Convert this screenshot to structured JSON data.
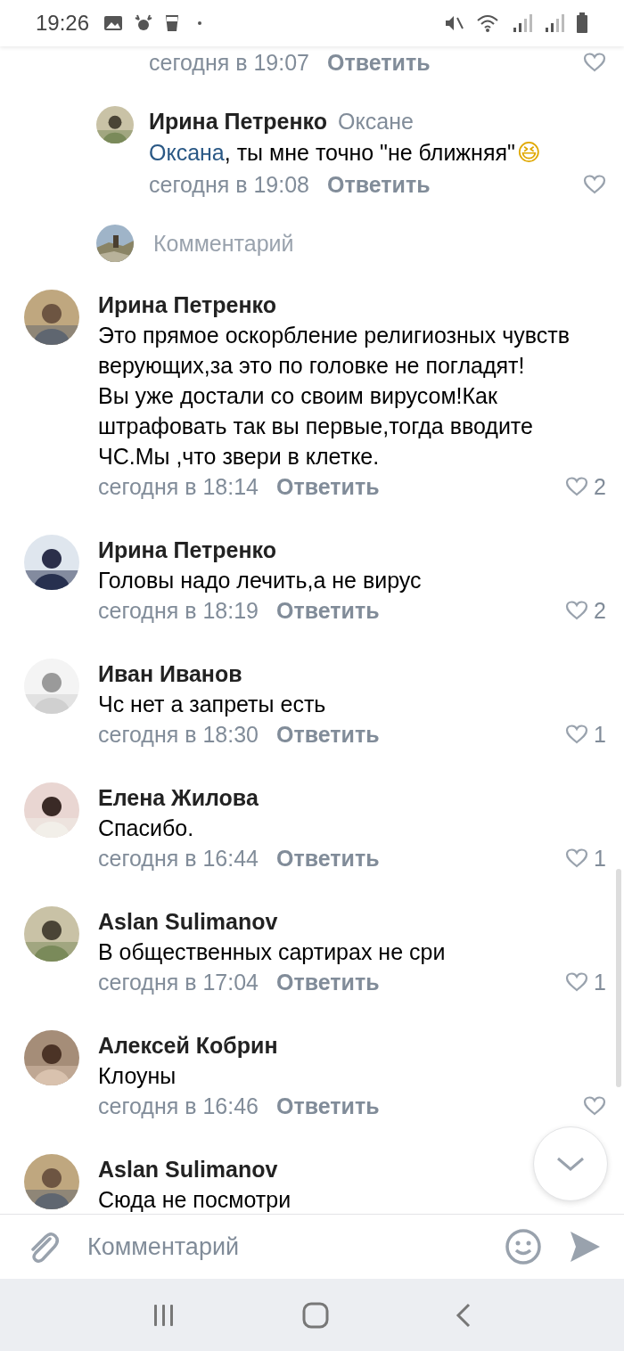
{
  "status_bar": {
    "time": "19:26"
  },
  "comments": [
    {
      "kind": "reply",
      "time": "сегодня в 19:07",
      "reply_action": "Ответить",
      "liked": false
    },
    {
      "kind": "reply",
      "author": "Ирина Петренко",
      "addressee": "Оксане",
      "mention": "Оксана",
      "text": ", ты мне точно \"не ближняя\"",
      "emoji": "😆",
      "time": "сегодня в 19:08",
      "reply_action": "Ответить",
      "liked": false
    },
    {
      "kind": "reply_input",
      "placeholder": "Комментарий"
    },
    {
      "kind": "comment",
      "author": "Ирина Петренко",
      "text": "Это прямое оскорбление религиозных чувств верующих,за это по головке не погладят!\nВы уже достали со своим вирусом!Как штрафовать так вы первые,тогда вводите ЧС.Мы ,что звери в клетке.",
      "time": "сегодня в 18:14",
      "reply_action": "Ответить",
      "liked": false,
      "likes": "2"
    },
    {
      "kind": "comment",
      "author": "Ирина Петренко",
      "text": "Головы надо лечить,а не вирус",
      "time": "сегодня в 18:19",
      "reply_action": "Ответить",
      "liked": false,
      "likes": "2"
    },
    {
      "kind": "comment",
      "author": "Иван Иванов",
      "text": "Чс нет а запреты есть",
      "time": "сегодня в 18:30",
      "reply_action": "Ответить",
      "liked": false,
      "likes": "1"
    },
    {
      "kind": "comment",
      "author": "Елена Жилова",
      "text": "Спасибо.",
      "time": "сегодня в 16:44",
      "reply_action": "Ответить",
      "liked": false,
      "likes": "1"
    },
    {
      "kind": "comment",
      "author": "Aslan Sulimanov",
      "text": "В общественных сартирах не сри",
      "time": "сегодня в 17:04",
      "reply_action": "Ответить",
      "liked": false,
      "likes": "1"
    },
    {
      "kind": "comment",
      "author": "Алексей Кобрин",
      "text": "Клоуны",
      "time": "сегодня в 16:46",
      "reply_action": "Ответить",
      "liked": false
    },
    {
      "kind": "comment",
      "author": "Aslan Sulimanov",
      "text": "Сюда не посмотри"
    }
  ],
  "composer": {
    "placeholder": "Комментарий"
  }
}
